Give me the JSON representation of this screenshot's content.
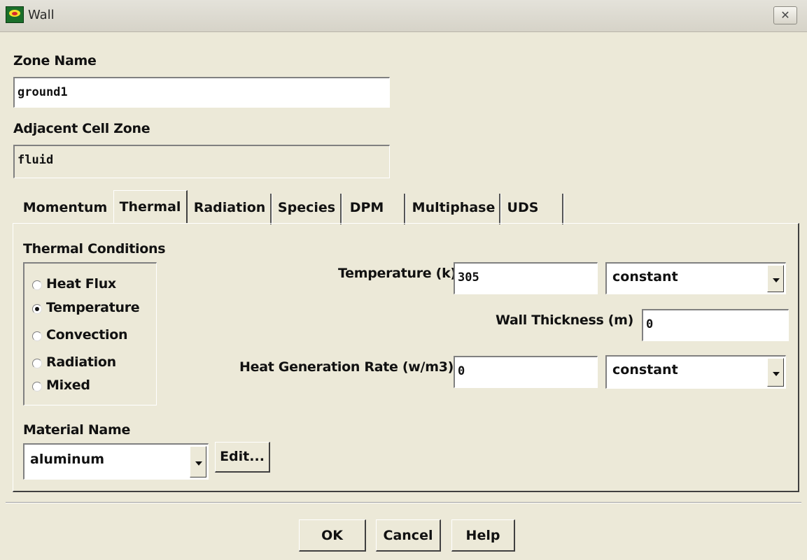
{
  "window": {
    "title": "Wall",
    "close_label": "✕"
  },
  "zone": {
    "zone_name_label": "Zone Name",
    "zone_name_value": "ground1",
    "adjacent_label": "Adjacent Cell Zone",
    "adjacent_value": "fluid"
  },
  "tabs": [
    {
      "label": "Momentum",
      "active": false
    },
    {
      "label": "Thermal",
      "active": true
    },
    {
      "label": "Radiation",
      "active": false
    },
    {
      "label": "Species",
      "active": false
    },
    {
      "label": "DPM",
      "active": false
    },
    {
      "label": "Multiphase",
      "active": false
    },
    {
      "label": "UDS",
      "active": false
    }
  ],
  "thermal": {
    "conditions_label": "Thermal Conditions",
    "options": [
      {
        "label": "Heat Flux",
        "checked": false
      },
      {
        "label": "Temperature",
        "checked": true
      },
      {
        "label": "Convection",
        "checked": false
      },
      {
        "label": "Radiation",
        "checked": false
      },
      {
        "label": "Mixed",
        "checked": false
      }
    ],
    "temperature_label": "Temperature (k)",
    "temperature_value": "305",
    "temperature_profile": "constant",
    "wall_thickness_label": "Wall Thickness (m)",
    "wall_thickness_value": "0",
    "heat_gen_label": "Heat Generation Rate (w/m3)",
    "heat_gen_value": "0",
    "heat_gen_profile": "constant",
    "material_label": "Material Name",
    "material_value": "aluminum",
    "edit_label": "Edit..."
  },
  "footer": {
    "ok_label": "OK",
    "cancel_label": "Cancel",
    "help_label": "Help"
  }
}
